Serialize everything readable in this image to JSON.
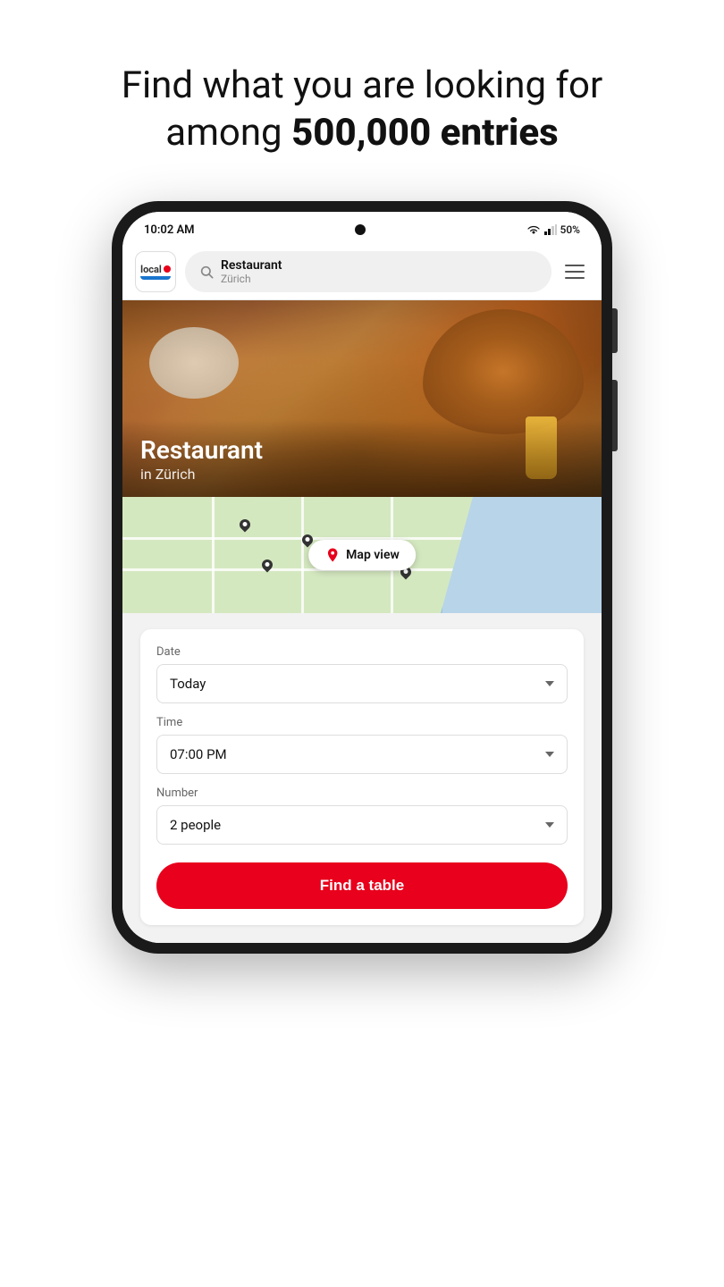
{
  "header": {
    "line1": "Find what you are looking for",
    "line2_normal": "among ",
    "line2_bold": "500,000 entries"
  },
  "status_bar": {
    "time": "10:02 AM",
    "battery": "50%"
  },
  "app_header": {
    "logo_text": "local",
    "search_main": "Restaurant",
    "search_sub": "Zürich",
    "menu_label": "Menu"
  },
  "hero": {
    "title": "Restaurant",
    "subtitle": "in Zürich"
  },
  "map": {
    "button_label": "Map view"
  },
  "booking": {
    "date_label": "Date",
    "date_value": "Today",
    "time_label": "Time",
    "time_value": "07:00 PM",
    "number_label": "Number",
    "number_value": "2 people",
    "find_button": "Find a table"
  },
  "colors": {
    "accent_red": "#e8001c",
    "logo_blue": "#1a75cf",
    "map_green": "#d4e8c0",
    "map_water": "#b8d4e8"
  }
}
